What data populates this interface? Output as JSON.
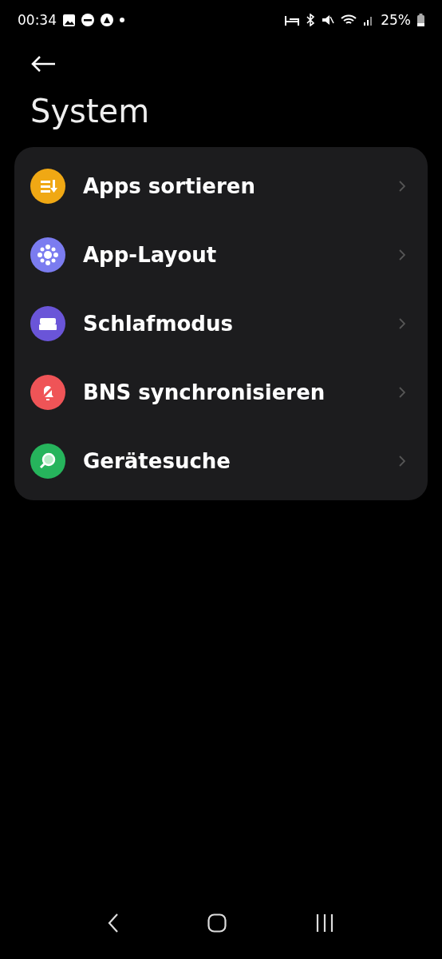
{
  "status_bar": {
    "time": "00:34",
    "battery": "25%"
  },
  "title": "System",
  "items": [
    {
      "label": "Apps sortieren",
      "kind": "sort",
      "color": "#f0a814"
    },
    {
      "label": "App-Layout",
      "kind": "layout",
      "color": "#7b7cf0"
    },
    {
      "label": "Schlafmodus",
      "kind": "sleep",
      "color": "#6a55d8"
    },
    {
      "label": "BNS synchronisieren",
      "kind": "mute",
      "color": "#ef5457"
    },
    {
      "label": "Gerätesuche",
      "kind": "search",
      "color": "#26b45c"
    }
  ]
}
